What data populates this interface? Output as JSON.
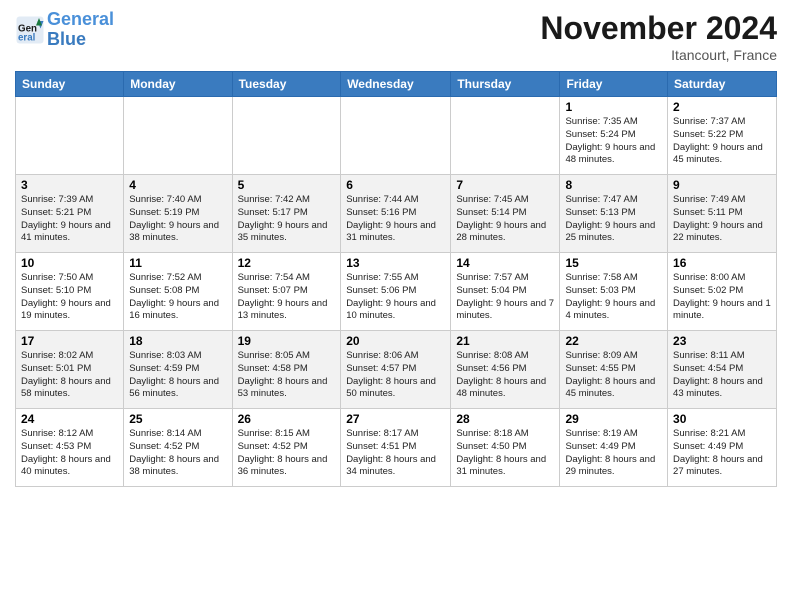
{
  "header": {
    "logo_line1": "General",
    "logo_line2": "Blue",
    "title": "November 2024",
    "subtitle": "Itancourt, France"
  },
  "weekdays": [
    "Sunday",
    "Monday",
    "Tuesday",
    "Wednesday",
    "Thursday",
    "Friday",
    "Saturday"
  ],
  "weeks": [
    [
      {
        "day": "",
        "info": ""
      },
      {
        "day": "",
        "info": ""
      },
      {
        "day": "",
        "info": ""
      },
      {
        "day": "",
        "info": ""
      },
      {
        "day": "",
        "info": ""
      },
      {
        "day": "1",
        "info": "Sunrise: 7:35 AM\nSunset: 5:24 PM\nDaylight: 9 hours and 48 minutes."
      },
      {
        "day": "2",
        "info": "Sunrise: 7:37 AM\nSunset: 5:22 PM\nDaylight: 9 hours and 45 minutes."
      }
    ],
    [
      {
        "day": "3",
        "info": "Sunrise: 7:39 AM\nSunset: 5:21 PM\nDaylight: 9 hours and 41 minutes."
      },
      {
        "day": "4",
        "info": "Sunrise: 7:40 AM\nSunset: 5:19 PM\nDaylight: 9 hours and 38 minutes."
      },
      {
        "day": "5",
        "info": "Sunrise: 7:42 AM\nSunset: 5:17 PM\nDaylight: 9 hours and 35 minutes."
      },
      {
        "day": "6",
        "info": "Sunrise: 7:44 AM\nSunset: 5:16 PM\nDaylight: 9 hours and 31 minutes."
      },
      {
        "day": "7",
        "info": "Sunrise: 7:45 AM\nSunset: 5:14 PM\nDaylight: 9 hours and 28 minutes."
      },
      {
        "day": "8",
        "info": "Sunrise: 7:47 AM\nSunset: 5:13 PM\nDaylight: 9 hours and 25 minutes."
      },
      {
        "day": "9",
        "info": "Sunrise: 7:49 AM\nSunset: 5:11 PM\nDaylight: 9 hours and 22 minutes."
      }
    ],
    [
      {
        "day": "10",
        "info": "Sunrise: 7:50 AM\nSunset: 5:10 PM\nDaylight: 9 hours and 19 minutes."
      },
      {
        "day": "11",
        "info": "Sunrise: 7:52 AM\nSunset: 5:08 PM\nDaylight: 9 hours and 16 minutes."
      },
      {
        "day": "12",
        "info": "Sunrise: 7:54 AM\nSunset: 5:07 PM\nDaylight: 9 hours and 13 minutes."
      },
      {
        "day": "13",
        "info": "Sunrise: 7:55 AM\nSunset: 5:06 PM\nDaylight: 9 hours and 10 minutes."
      },
      {
        "day": "14",
        "info": "Sunrise: 7:57 AM\nSunset: 5:04 PM\nDaylight: 9 hours and 7 minutes."
      },
      {
        "day": "15",
        "info": "Sunrise: 7:58 AM\nSunset: 5:03 PM\nDaylight: 9 hours and 4 minutes."
      },
      {
        "day": "16",
        "info": "Sunrise: 8:00 AM\nSunset: 5:02 PM\nDaylight: 9 hours and 1 minute."
      }
    ],
    [
      {
        "day": "17",
        "info": "Sunrise: 8:02 AM\nSunset: 5:01 PM\nDaylight: 8 hours and 58 minutes."
      },
      {
        "day": "18",
        "info": "Sunrise: 8:03 AM\nSunset: 4:59 PM\nDaylight: 8 hours and 56 minutes."
      },
      {
        "day": "19",
        "info": "Sunrise: 8:05 AM\nSunset: 4:58 PM\nDaylight: 8 hours and 53 minutes."
      },
      {
        "day": "20",
        "info": "Sunrise: 8:06 AM\nSunset: 4:57 PM\nDaylight: 8 hours and 50 minutes."
      },
      {
        "day": "21",
        "info": "Sunrise: 8:08 AM\nSunset: 4:56 PM\nDaylight: 8 hours and 48 minutes."
      },
      {
        "day": "22",
        "info": "Sunrise: 8:09 AM\nSunset: 4:55 PM\nDaylight: 8 hours and 45 minutes."
      },
      {
        "day": "23",
        "info": "Sunrise: 8:11 AM\nSunset: 4:54 PM\nDaylight: 8 hours and 43 minutes."
      }
    ],
    [
      {
        "day": "24",
        "info": "Sunrise: 8:12 AM\nSunset: 4:53 PM\nDaylight: 8 hours and 40 minutes."
      },
      {
        "day": "25",
        "info": "Sunrise: 8:14 AM\nSunset: 4:52 PM\nDaylight: 8 hours and 38 minutes."
      },
      {
        "day": "26",
        "info": "Sunrise: 8:15 AM\nSunset: 4:52 PM\nDaylight: 8 hours and 36 minutes."
      },
      {
        "day": "27",
        "info": "Sunrise: 8:17 AM\nSunset: 4:51 PM\nDaylight: 8 hours and 34 minutes."
      },
      {
        "day": "28",
        "info": "Sunrise: 8:18 AM\nSunset: 4:50 PM\nDaylight: 8 hours and 31 minutes."
      },
      {
        "day": "29",
        "info": "Sunrise: 8:19 AM\nSunset: 4:49 PM\nDaylight: 8 hours and 29 minutes."
      },
      {
        "day": "30",
        "info": "Sunrise: 8:21 AM\nSunset: 4:49 PM\nDaylight: 8 hours and 27 minutes."
      }
    ]
  ]
}
